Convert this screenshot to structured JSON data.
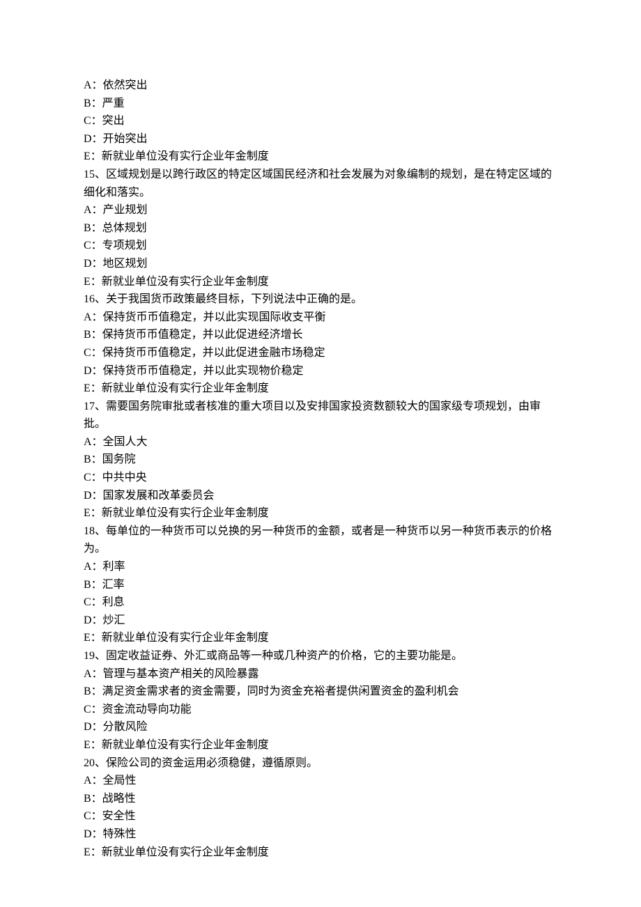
{
  "q14_partial": {
    "options": [
      "A：依然突出",
      "B：严重",
      "C：突出",
      "D：开始突出",
      "E：新就业单位没有实行企业年金制度"
    ]
  },
  "questions": [
    {
      "stem": "15、区域规划是以跨行政区的特定区域国民经济和社会发展为对象编制的规划，是在特定区域的细化和落实。",
      "options": [
        "A：产业规划",
        "B：总体规划",
        "C：专项规划",
        "D：地区规划",
        "E：新就业单位没有实行企业年金制度"
      ]
    },
    {
      "stem": "16、关于我国货币政策最终目标，下列说法中正确的是。",
      "options": [
        "A：保持货币币值稳定，并以此实现国际收支平衡",
        "B：保持货币币值稳定，并以此促进经济增长",
        "C：保持货币币值稳定，并以此促进金融市场稳定",
        "D：保持货币币值稳定，并以此实现物价稳定",
        "E：新就业单位没有实行企业年金制度"
      ]
    },
    {
      "stem": "17、需要国务院审批或者核准的重大项目以及安排国家投资数额较大的国家级专项规划，由审批。",
      "options": [
        "A：全国人大",
        "B：国务院",
        "C：中共中央",
        "D：国家发展和改革委员会",
        "E：新就业单位没有实行企业年金制度"
      ]
    },
    {
      "stem": "18、每单位的一种货币可以兑换的另一种货币的金额，或者是一种货币以另一种货币表示的价格为。",
      "options": [
        "A：利率",
        "B：汇率",
        "C：利息",
        "D：炒汇",
        "E：新就业单位没有实行企业年金制度"
      ]
    },
    {
      "stem": "19、固定收益证券、外汇或商品等一种或几种资产的价格，它的主要功能是。",
      "options": [
        "A：管理与基本资产相关的风险暴露",
        "B：满足资金需求者的资金需要，同时为资金充裕者提供闲置资金的盈利机会",
        "C：资金流动导向功能",
        "D：分散风险",
        "E：新就业单位没有实行企业年金制度"
      ]
    },
    {
      "stem": "20、保险公司的资金运用必须稳健，遵循原则。",
      "options": [
        "A：全局性",
        "B：战略性",
        "C：安全性",
        "D：特殊性",
        "E：新就业单位没有实行企业年金制度"
      ]
    }
  ]
}
